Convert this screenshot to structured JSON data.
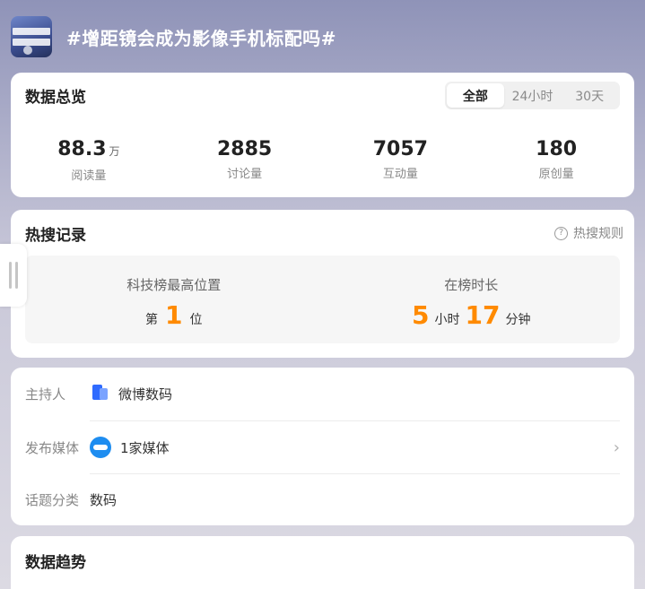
{
  "header": {
    "thumbnail_icon": "topic-thumbnail",
    "title": "#增距镜会成为影像手机标配吗#"
  },
  "overview": {
    "title": "数据总览",
    "tabs": [
      {
        "label": "全部",
        "active": true
      },
      {
        "label": "24小时",
        "active": false
      },
      {
        "label": "30天",
        "active": false
      }
    ],
    "stats": [
      {
        "value": "88.3",
        "unit": "万",
        "label": "阅读量"
      },
      {
        "value": "2885",
        "unit": "",
        "label": "讨论量"
      },
      {
        "value": "7057",
        "unit": "",
        "label": "互动量"
      },
      {
        "value": "180",
        "unit": "",
        "label": "原创量"
      }
    ]
  },
  "hot": {
    "title": "热搜记录",
    "rules_label": "热搜规则",
    "rank": {
      "label": "科技榜最高位置",
      "prefix": "第",
      "value": "1",
      "suffix": "位"
    },
    "duration": {
      "label": "在榜时长",
      "hours": "5",
      "hours_unit": "小时",
      "minutes": "17",
      "minutes_unit": "分钟"
    }
  },
  "info": {
    "host": {
      "label": "主持人",
      "value": "微博数码",
      "icon": "weibo-digital-icon"
    },
    "media": {
      "label": "发布媒体",
      "value": "1家媒体",
      "icon": "media-logo-icon"
    },
    "category": {
      "label": "话题分类",
      "value": "数码"
    }
  },
  "trend": {
    "title": "数据趋势"
  },
  "colors": {
    "accent_orange": "#ff8a00",
    "brand_blue": "#2f6bff"
  }
}
